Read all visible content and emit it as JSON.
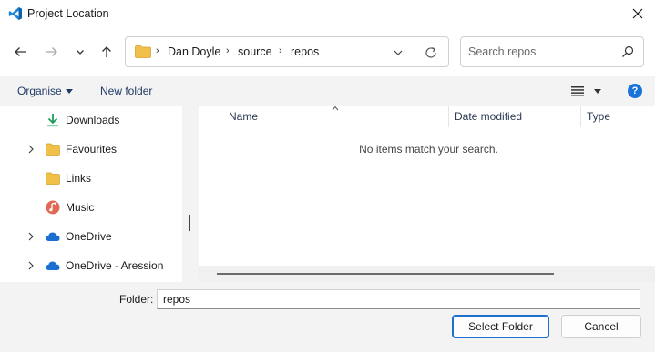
{
  "window": {
    "title": "Project Location",
    "accent": "#1f6fd1"
  },
  "nav": {
    "back_icon": "arrow-left-icon",
    "forward_icon": "arrow-right-icon",
    "recent_icon": "chevron-down-icon",
    "up_icon": "arrow-up-icon"
  },
  "address": {
    "breadcrumbs": [
      "Dan Doyle",
      "source",
      "repos"
    ]
  },
  "search": {
    "placeholder": "Search repos",
    "value": ""
  },
  "toolbar": {
    "organise_label": "Organise",
    "new_folder_label": "New folder",
    "help_label": "?"
  },
  "sidebar": {
    "items": [
      {
        "label": "Downloads",
        "icon": "download-icon",
        "expandable": false
      },
      {
        "label": "Favourites",
        "icon": "folder-icon",
        "expandable": true
      },
      {
        "label": "Links",
        "icon": "folder-icon",
        "expandable": false
      },
      {
        "label": "Music",
        "icon": "music-icon",
        "expandable": false
      },
      {
        "label": "OneDrive",
        "icon": "cloud-icon",
        "expandable": true
      },
      {
        "label": "OneDrive - Aression",
        "icon": "cloud-icon",
        "expandable": true
      }
    ]
  },
  "filelist": {
    "columns": [
      "Name",
      "Date modified",
      "Type"
    ],
    "empty_message": "No items match your search."
  },
  "footer": {
    "folder_label": "Folder:",
    "folder_value": "repos",
    "select_label": "Select Folder",
    "cancel_label": "Cancel"
  }
}
